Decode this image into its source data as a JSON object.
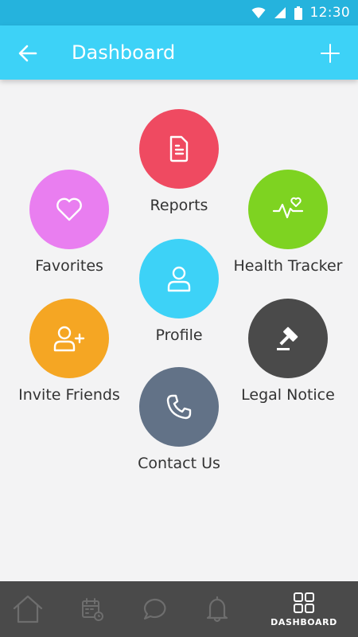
{
  "status_bar": {
    "time": "12:30"
  },
  "app_bar": {
    "title": "Dashboard"
  },
  "tiles": [
    {
      "label": "Reports",
      "color": "#ef4a61",
      "icon": "document-icon"
    },
    {
      "label": "Favorites",
      "color": "#e97ef0",
      "icon": "heart-icon"
    },
    {
      "label": "Health Tracker",
      "color": "#7ed321",
      "icon": "heart-pulse-icon"
    },
    {
      "label": "Profile",
      "color": "#3dd2f7",
      "icon": "user-icon"
    },
    {
      "label": "Invite Friends",
      "color": "#f5a623",
      "icon": "add-user-icon"
    },
    {
      "label": "Legal Notice",
      "color": "#4a4a4a",
      "icon": "gavel-icon"
    },
    {
      "label": "Contact Us",
      "color": "#627287",
      "icon": "phone-icon"
    }
  ],
  "bottom_nav": {
    "items": [
      {
        "icon": "home-icon"
      },
      {
        "icon": "calendar-icon"
      },
      {
        "icon": "chat-icon"
      },
      {
        "icon": "bell-icon"
      },
      {
        "icon": "grid-icon",
        "label": "DASHBOARD",
        "active": true
      }
    ]
  },
  "colors": {
    "status_bar": "#25b3dd",
    "app_bar": "#3dd2f7",
    "background": "#f3f3f4",
    "bottom_nav": "#4a4a4a"
  }
}
